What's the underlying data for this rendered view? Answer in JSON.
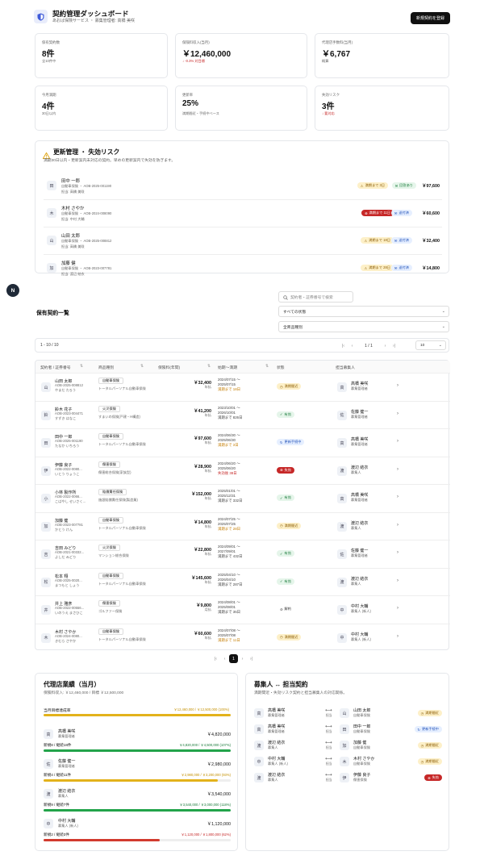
{
  "header": {
    "title": "契約管理ダッシュボード",
    "subtitle": "あおば保険サービス ・ 募集管理者: 高橋 美咲",
    "new_button": "新規契約を登録"
  },
  "kpis": [
    {
      "label": "保有契約数",
      "value": "8件",
      "sub": "全10件中"
    },
    {
      "label": "保険料収入(当月)",
      "value": "￥12,460,000",
      "sub": "↓ -0.3% 対目標",
      "sub_color": "#c62828"
    },
    {
      "label": "代理店手数料(当月)",
      "value": "￥6,767",
      "sub": "概算"
    },
    {
      "label": "今月満期",
      "value": "4件",
      "sub": "30日以内"
    },
    {
      "label": "更新率",
      "value": "25%",
      "sub": "満期間近・手続中ベース"
    },
    {
      "label": "失効リスク",
      "value": "3件",
      "sub": "↓ 要対応",
      "sub_color": "#c62828"
    }
  ],
  "renewal": {
    "title": "更新管理 ・ 失効リスク",
    "subtitle": "満期30日以内・更新案内未対応の契約。早めの更新案内で失効を防ぎます。",
    "items": [
      {
        "avatar": "田",
        "name": "田中 一郎",
        "detail": "自動車保険 ・ AOB-2025-001190",
        "owner": "担当: 高橋 美咲",
        "badge": "満期まで 3日",
        "badge_kind": "yellow",
        "badge2": "回答あり",
        "badge2_kind": "green",
        "amount": "￥97,600"
      },
      {
        "avatar": "木",
        "name": "木村 さやか",
        "detail": "自動車保険 ・ AOB-2024-008090",
        "owner": "担当: 中村 大輔",
        "badge": "満期まで 11日",
        "badge_kind": "red",
        "badge2": "送付済",
        "badge2_kind": "blue",
        "amount": "￥60,600"
      },
      {
        "avatar": "山",
        "name": "山田 太郎",
        "detail": "自動車保険 ・ AOB-2025-008812",
        "owner": "担当: 高橋 美咲",
        "badge": "満期まで 18日",
        "badge_kind": "yellow",
        "badge2": "送付済",
        "badge2_kind": "blue",
        "amount": "￥32,400"
      },
      {
        "avatar": "加",
        "name": "加藤 健",
        "detail": "自動車保険 ・ AOB-2023-007781",
        "owner": "担当: 渡辺 結衣",
        "badge": "満期まで 28日",
        "badge_kind": "yellow",
        "badge2": "送付済",
        "badge2_kind": "blue",
        "amount": "￥14,800"
      }
    ]
  },
  "float_button": "N",
  "contracts": {
    "title": "保有契約一覧",
    "search_placeholder": "契約者・証券番号で検索",
    "status_filter": "すべての状態",
    "product_filter": "全商品種別",
    "page_info": "1 - 10 / 10",
    "page_number": "1 / 1",
    "page_size": "10",
    "headers": [
      "契約者 / 証券番号",
      "商品種別",
      "保険料(年間)",
      "始期〜満期",
      "状態",
      "担当募集人"
    ],
    "rows": [
      {
        "av": "山",
        "name": "山田 太郎",
        "policy": "AOB-2025-008812",
        "kana": "やまだ たろう",
        "product": "自動車保険",
        "desc": "トータルパーソナル自動車保険",
        "premium": "￥32,400",
        "freq": "年払",
        "period": "2024/07/15 〜",
        "period2": "2025/07/15",
        "note": "満期まで 18日",
        "note_kind": "warn",
        "status": "満期間近",
        "status_kind": "yellow",
        "agent_av": "高",
        "agent": "高橋 美咲",
        "agent_role": "募集管理者"
      },
      {
        "av": "鈴",
        "name": "鈴木 花子",
        "policy": "AOB-2023-004471",
        "kana": "すずき はなこ",
        "product": "火災保険",
        "desc": "すまいの保険(戸建・H構造)",
        "premium": "￥41,200",
        "freq": "年払",
        "period": "2023/10/01 〜",
        "period2": "2026/10/01",
        "note": "満期まで 826日",
        "note_kind": "",
        "status": "有効",
        "status_kind": "green",
        "agent_av": "佐",
        "agent": "佐藤 健一",
        "agent_role": "募集管理者"
      },
      {
        "av": "田",
        "name": "田中 一郎",
        "policy": "AOB-2025-001190",
        "kana": "たなか いちろう",
        "product": "自動車保険",
        "desc": "トータルパーソナル自動車保険",
        "premium": "￥97,600",
        "freq": "年払",
        "period": "2024/06/30 〜",
        "period2": "2025/06/30",
        "note": "満期まで 3日",
        "note_kind": "warn",
        "status": "更新手続中",
        "status_kind": "blue",
        "agent_av": "高",
        "agent": "高橋 美咲",
        "agent_role": "募集管理者"
      },
      {
        "av": "伊",
        "name": "伊藤 良子",
        "policy": "AOB-2022-0080...",
        "kana": "いとう りょうこ",
        "product": "傷害保険",
        "desc": "傷害総合保険(家族型)",
        "premium": "￥28,900",
        "freq": "年払",
        "period": "2024/06/20 〜",
        "period2": "2025/06/20",
        "note": "失効後 38日",
        "note_kind": "red",
        "status": "失効",
        "status_kind": "red",
        "agent_av": "渡",
        "agent": "渡辺 結衣",
        "agent_role": "募集人"
      },
      {
        "av": "小",
        "name": "小林 製作所",
        "policy": "AOB-2022-0066...",
        "kana": "こばやし せいさく...",
        "product": "賠償責任保険",
        "desc": "施設賠償責任保険(製造業)",
        "premium": "￥152,000",
        "freq": "年払",
        "period": "2025/01/01 〜",
        "period2": "2025/12/31",
        "note": "満期まで 332日",
        "note_kind": "",
        "status": "有効",
        "status_kind": "green",
        "agent_av": "高",
        "agent": "高橋 美咲",
        "agent_role": "募集管理者"
      },
      {
        "av": "加",
        "name": "加藤 健",
        "policy": "AOB-2023-007781",
        "kana": "かとう けん",
        "product": "自動車保険",
        "desc": "トータルパーソナル自動車保険",
        "premium": "￥14,800",
        "freq": "年払",
        "period": "2024/07/25 〜",
        "period2": "2025/07/25",
        "note": "満期まで 28日",
        "note_kind": "warn",
        "status": "満期間近",
        "status_kind": "yellow",
        "agent_av": "渡",
        "agent": "渡辺 結衣",
        "agent_role": "募集人"
      },
      {
        "av": "吉",
        "name": "吉田 みどり",
        "policy": "AOB-2021-00332...",
        "kana": "よしだ みどり",
        "product": "火災保険",
        "desc": "マンション総合保険",
        "premium": "￥22,800",
        "freq": "年払",
        "period": "2024/09/01 〜",
        "period2": "2027/09/01",
        "note": "満期まで 432日",
        "note_kind": "",
        "status": "有効",
        "status_kind": "green",
        "agent_av": "佐",
        "agent": "佐藤 健一",
        "agent_role": "募集管理者"
      },
      {
        "av": "松",
        "name": "松本 翔",
        "policy": "AOB-2025-0020...",
        "kana": "まつもと しょう",
        "product": "自動車保険",
        "desc": "トータルパーソナル自動車保険",
        "premium": "￥145,600",
        "freq": "年払",
        "period": "2025/04/10 〜",
        "period2": "2026/04/10",
        "note": "満期まで 287日",
        "note_kind": "",
        "status": "有効",
        "status_kind": "green",
        "agent_av": "渡",
        "agent": "渡辺 結衣",
        "agent_role": "募集人"
      },
      {
        "av": "井",
        "name": "井上 雅彦",
        "policy": "AOB-2022-00556...",
        "kana": "いのうえ まさひこ",
        "product": "傷害保険",
        "desc": "ゴルファー保険",
        "premium": "￥9,800",
        "freq": "月払",
        "period": "2024/08/01 〜",
        "period2": "2025/08/01",
        "note": "満期まで 35日",
        "note_kind": "",
        "status": "解約",
        "status_kind": "gray",
        "agent_av": "中",
        "agent": "中村 大輔",
        "agent_role": "募集人 (新人)"
      },
      {
        "av": "木",
        "name": "木村 さやか",
        "policy": "AOB-2024-0080...",
        "kana": "きむら さやか",
        "product": "自動車保険",
        "desc": "トータルパーソナル自動車保険",
        "premium": "￥60,600",
        "freq": "年払",
        "period": "2024/07/08 〜",
        "period2": "2025/07/08",
        "note": "満期まで 11日",
        "note_kind": "warn",
        "status": "満期間近",
        "status_kind": "yellow",
        "agent_av": "中",
        "agent": "中村 大輔",
        "agent_role": "募集人 (新人)"
      }
    ]
  },
  "agency": {
    "title": "代理店業績（当月）",
    "subtitle": "保険料収入: ￥12,460,000 / 目標 ￥12,500,000",
    "overall": {
      "label": "当月目標達成率",
      "text": "￥12,460,000 / ￥12,500,000 (100%)",
      "ratio": 1.0,
      "color": "#e3b21b"
    },
    "agents": [
      {
        "av": "高",
        "name": "高橋 美咲",
        "role": "募集管理者",
        "amount": "￥4,820,000",
        "count": "新規8 / 継続18件",
        "progress": "￥4,820,000 / ￥4,500,000 (107%)",
        "ratio": 1.0,
        "color": "#22a34a"
      },
      {
        "av": "佐",
        "name": "佐藤 健一",
        "role": "募集管理者",
        "amount": "￥2,980,000",
        "count": "新規4 / 継続11件",
        "progress": "￥2,980,000 / ￥3,200,000 (93%)",
        "ratio": 0.93,
        "color": "#e3b21b"
      },
      {
        "av": "渡",
        "name": "渡辺 結衣",
        "role": "募集人",
        "amount": "￥3,540,000",
        "count": "新規9 / 継続7件",
        "progress": "￥3,540,000 / ￥3,000,000 (118%)",
        "ratio": 1.0,
        "color": "#22a34a"
      },
      {
        "av": "中",
        "name": "中村 大輔",
        "role": "募集人 (新人)",
        "amount": "￥1,120,000",
        "count": "新規2 / 継続3件",
        "progress": "￥1,120,000 / ￥1,800,000 (62%)",
        "ratio": 0.62,
        "color": "#d23b2e"
      }
    ]
  },
  "mapping": {
    "title": "募集人 ↔ 担当契約",
    "subtitle": "満期間近・失効リスク契約と担当募集人の対応関係。",
    "links": [
      {
        "a_av": "高",
        "a_name": "高橋 美咲",
        "a_role": "募集管理者",
        "b_av": "山",
        "b_name": "山田 太郎",
        "b_prod": "自動車保険",
        "status": "満期間近",
        "status_kind": "yellow"
      },
      {
        "a_av": "高",
        "a_name": "高橋 美咲",
        "a_role": "募集管理者",
        "b_av": "田",
        "b_name": "田中 一郎",
        "b_prod": "自動車保険",
        "status": "更新手続中",
        "status_kind": "blue"
      },
      {
        "a_av": "渡",
        "a_name": "渡辺 結衣",
        "a_role": "募集人",
        "b_av": "加",
        "b_name": "加藤 健",
        "b_prod": "自動車保険",
        "status": "満期間近",
        "status_kind": "yellow"
      },
      {
        "a_av": "中",
        "a_name": "中村 大輔",
        "a_role": "募集人 (新人)",
        "b_av": "木",
        "b_name": "木村 さやか",
        "b_prod": "自動車保険",
        "status": "満期間近",
        "status_kind": "yellow"
      },
      {
        "a_av": "渡",
        "a_name": "渡辺 結衣",
        "a_role": "募集人",
        "b_av": "伊",
        "b_name": "伊藤 良子",
        "b_prod": "傷害保険",
        "status": "失効",
        "status_kind": "red"
      }
    ],
    "link_label": "担当"
  }
}
